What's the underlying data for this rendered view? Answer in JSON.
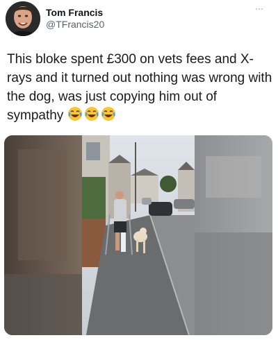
{
  "tweet": {
    "author": {
      "display_name": "Tom Francis",
      "handle": "@TFrancis20"
    },
    "text": "This bloke spent £300 on vets fees and X-rays and it turned out nothing was wrong with the dog, was just copying him out of sympathy",
    "emojis": [
      "laughing-crying-face-icon",
      "laughing-crying-face-icon",
      "laughing-crying-face-icon"
    ],
    "more_icon": "more-horizontal-icon",
    "media": {
      "type": "video-frame"
    }
  }
}
